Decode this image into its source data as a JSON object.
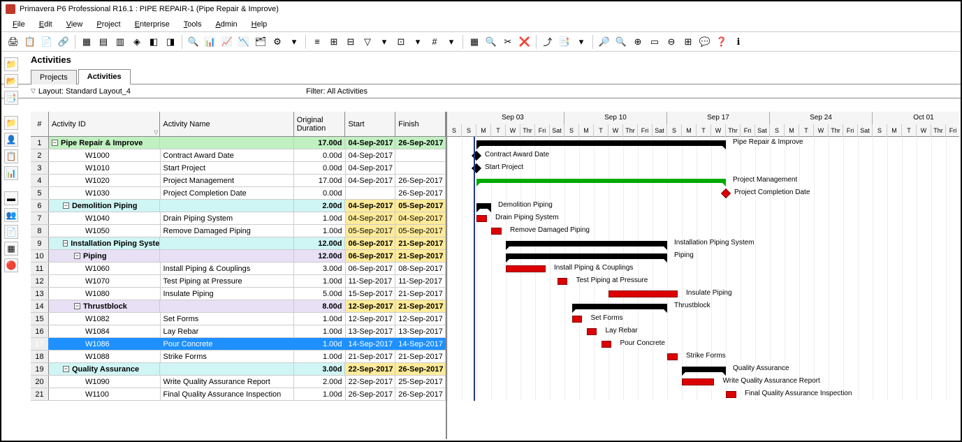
{
  "title": "Primavera P6 Professional R16.1 : PIPE REPAIR-1 (Pipe Repair & Improve)",
  "menus": [
    "File",
    "Edit",
    "View",
    "Project",
    "Enterprise",
    "Tools",
    "Admin",
    "Help"
  ],
  "section": "Activities",
  "tabs": {
    "projects": "Projects",
    "activities": "Activities"
  },
  "layout": {
    "label": "Layout: Standard Layout_4",
    "filter": "Filter: All Activities"
  },
  "columns": {
    "num": "#",
    "id": "Activity ID",
    "name": "Activity Name",
    "dur": "Original Duration",
    "start": "Start",
    "finish": "Finish"
  },
  "timeline": {
    "weeks": [
      "Sep 03",
      "Sep 10",
      "Sep 17",
      "Sep 24",
      "Oct 01"
    ],
    "days": [
      "S",
      "M",
      "T",
      "W",
      "Thr",
      "Fri",
      "Sat"
    ]
  },
  "chart_data": {
    "type": "gantt",
    "rows": [
      {
        "n": 1,
        "lvl": 0,
        "id": "",
        "name": "Pipe Repair & Improve",
        "dur": "17.00d",
        "start": "04-Sep-2017",
        "finish": "26-Sep-2017",
        "bar": {
          "type": "sum",
          "s": 0,
          "e": 17
        }
      },
      {
        "n": 2,
        "lvl": 3,
        "id": "W1000",
        "name": "Contract Award Date",
        "dur": "0.00d",
        "start": "04-Sep-2017",
        "finish": "",
        "bar": {
          "type": "ms",
          "s": 0
        }
      },
      {
        "n": 3,
        "lvl": 3,
        "id": "W1010",
        "name": "Start Project",
        "dur": "0.00d",
        "start": "04-Sep-2017",
        "finish": "",
        "bar": {
          "type": "ms",
          "s": 0
        }
      },
      {
        "n": 4,
        "lvl": 3,
        "id": "W1020",
        "name": "Project Management",
        "dur": "17.00d",
        "start": "04-Sep-2017",
        "finish": "26-Sep-2017",
        "bar": {
          "type": "sum",
          "s": 0,
          "e": 17,
          "green": true
        }
      },
      {
        "n": 5,
        "lvl": 3,
        "id": "W1030",
        "name": "Project Completion Date",
        "dur": "0.00d",
        "start": "",
        "finish": "26-Sep-2017",
        "bar": {
          "type": "msr",
          "s": 17
        }
      },
      {
        "n": 6,
        "lvl": 1,
        "id": "",
        "name": "Demolition Piping",
        "dur": "2.00d",
        "start": "04-Sep-2017",
        "finish": "05-Sep-2017",
        "hs": true,
        "hf": true,
        "bar": {
          "type": "sum",
          "s": 0,
          "e": 1
        }
      },
      {
        "n": 7,
        "lvl": 3,
        "id": "W1040",
        "name": "Drain Piping System",
        "dur": "1.00d",
        "start": "04-Sep-2017",
        "finish": "04-Sep-2017",
        "hs": true,
        "hf": true,
        "bar": {
          "type": "task",
          "s": 0,
          "e": 0
        }
      },
      {
        "n": 8,
        "lvl": 3,
        "id": "W1050",
        "name": "Remove Damaged Piping",
        "dur": "1.00d",
        "start": "05-Sep-2017",
        "finish": "05-Sep-2017",
        "hs": true,
        "hf": true,
        "bar": {
          "type": "task",
          "s": 1,
          "e": 1
        }
      },
      {
        "n": 9,
        "lvl": 1,
        "id": "",
        "name": "Installation Piping System",
        "dur": "12.00d",
        "start": "06-Sep-2017",
        "finish": "21-Sep-2017",
        "hs": true,
        "hf": true,
        "bar": {
          "type": "sum",
          "s": 2,
          "e": 13
        }
      },
      {
        "n": 10,
        "lvl": 2,
        "id": "",
        "name": "Piping",
        "dur": "12.00d",
        "start": "06-Sep-2017",
        "finish": "21-Sep-2017",
        "hs": true,
        "hf": true,
        "bar": {
          "type": "sum",
          "s": 2,
          "e": 13
        }
      },
      {
        "n": 11,
        "lvl": 3,
        "id": "W1060",
        "name": "Install Piping & Couplings",
        "dur": "3.00d",
        "start": "06-Sep-2017",
        "finish": "08-Sep-2017",
        "bar": {
          "type": "task",
          "s": 2,
          "e": 4
        }
      },
      {
        "n": 12,
        "lvl": 3,
        "id": "W1070",
        "name": "Test Piping at Pressure",
        "dur": "1.00d",
        "start": "11-Sep-2017",
        "finish": "11-Sep-2017",
        "bar": {
          "type": "task",
          "s": 5.5,
          "e": 5.5
        }
      },
      {
        "n": 13,
        "lvl": 3,
        "id": "W1080",
        "name": "Insulate Piping",
        "dur": "5.00d",
        "start": "15-Sep-2017",
        "finish": "21-Sep-2017",
        "bar": {
          "type": "task",
          "s": 9,
          "e": 13
        }
      },
      {
        "n": 14,
        "lvl": 2,
        "id": "",
        "name": "Thrustblock",
        "dur": "8.00d",
        "start": "12-Sep-2017",
        "finish": "21-Sep-2017",
        "hs": true,
        "hf": true,
        "bar": {
          "type": "sum",
          "s": 6.5,
          "e": 13
        }
      },
      {
        "n": 15,
        "lvl": 3,
        "id": "W1082",
        "name": "Set Forms",
        "dur": "1.00d",
        "start": "12-Sep-2017",
        "finish": "12-Sep-2017",
        "bar": {
          "type": "task",
          "s": 6.5,
          "e": 6.5
        }
      },
      {
        "n": 16,
        "lvl": 3,
        "id": "W1084",
        "name": "Lay Rebar",
        "dur": "1.00d",
        "start": "13-Sep-2017",
        "finish": "13-Sep-2017",
        "bar": {
          "type": "task",
          "s": 7.5,
          "e": 7.5
        }
      },
      {
        "n": 17,
        "lvl": 3,
        "id": "W1086",
        "name": "Pour Concrete",
        "dur": "1.00d",
        "start": "14-Sep-2017",
        "finish": "14-Sep-2017",
        "sel": true,
        "bar": {
          "type": "task",
          "s": 8.5,
          "e": 8.5
        }
      },
      {
        "n": 18,
        "lvl": 3,
        "id": "W1088",
        "name": "Strike Forms",
        "dur": "1.00d",
        "start": "21-Sep-2017",
        "finish": "21-Sep-2017",
        "bar": {
          "type": "task",
          "s": 13,
          "e": 13
        }
      },
      {
        "n": 19,
        "lvl": 1,
        "id": "",
        "name": "Quality Assurance",
        "dur": "3.00d",
        "start": "22-Sep-2017",
        "finish": "26-Sep-2017",
        "hs": true,
        "hf": true,
        "bar": {
          "type": "sum",
          "s": 14,
          "e": 17
        }
      },
      {
        "n": 20,
        "lvl": 3,
        "id": "W1090",
        "name": "Write Quality Assurance Report",
        "dur": "2.00d",
        "start": "22-Sep-2017",
        "finish": "25-Sep-2017",
        "bar": {
          "type": "task",
          "s": 14,
          "e": 15.5
        }
      },
      {
        "n": 21,
        "lvl": 3,
        "id": "W1100",
        "name": "Final Quality Assurance Inspection",
        "dur": "1.00d",
        "start": "26-Sep-2017",
        "finish": "26-Sep-2017",
        "bar": {
          "type": "task",
          "s": 17,
          "e": 17
        }
      }
    ]
  }
}
